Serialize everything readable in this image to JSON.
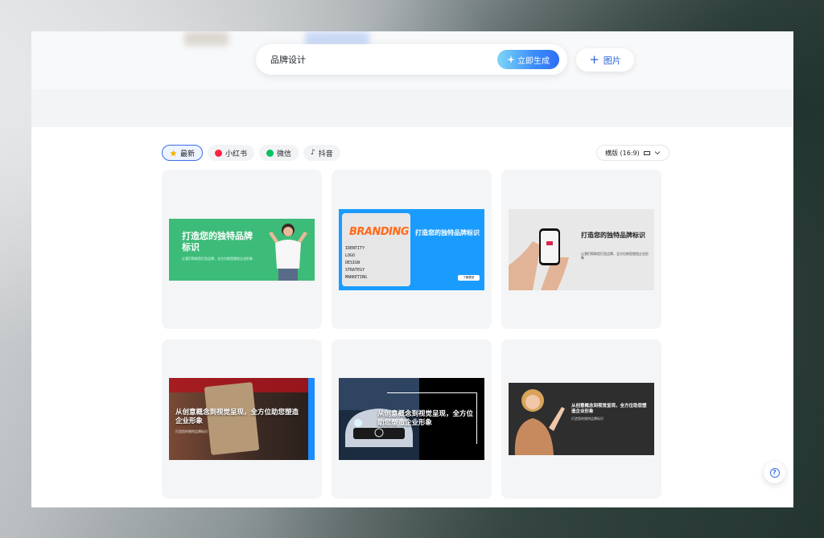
{
  "search": {
    "value": "品牌设计",
    "generate_label": "立即生成",
    "generate_icon": "sparkle-icon"
  },
  "image_button": {
    "label": "图片",
    "icon": "plus-icon"
  },
  "filters": [
    {
      "label": "最新",
      "icon": "star-icon",
      "color": "#f5b400",
      "active": true
    },
    {
      "label": "小红书",
      "icon": "xiaohongshu-icon",
      "color": "#ff2442",
      "active": false
    },
    {
      "label": "微信",
      "icon": "wechat-icon",
      "color": "#07c160",
      "active": false
    },
    {
      "label": "抖音",
      "icon": "douyin-icon",
      "color": "#111111",
      "active": false
    }
  ],
  "ratio_select": {
    "label": "横版 (16:9)"
  },
  "templates": [
    {
      "title": "打造您的独特品牌标识",
      "sub": "让我们帮助您打造品牌，全方位助您塑造企业形象",
      "bg": "#3dbc79"
    },
    {
      "title": "打造您的独特品牌标识",
      "art": "BRANDING",
      "lines": [
        "IDENTITY",
        "LOGO",
        "DESIGN",
        "STRATEGY",
        "MARKETING"
      ],
      "button": "了解更多",
      "bg": "#1a9cff"
    },
    {
      "title": "打造您的独特品牌标识",
      "sub": "让我们帮助您打造品牌，全方位助您塑造企业形象",
      "bg": "#e8e8e8"
    },
    {
      "title": "从创意概念到视觉呈现，全方位助您塑造企业形象",
      "sub": "打造您的独特品牌标识",
      "bg": "#6a3a2a"
    },
    {
      "title": "从创意概念到视觉呈现，全方位助您塑造企业形象",
      "bg": "#000000"
    },
    {
      "title": "从创意概念到视觉呈现，全方位助您塑造企业形象",
      "sub": "打造您的独特品牌标识",
      "bg": "#2e2e2e"
    }
  ],
  "colors": {
    "accent": "#2f6cf6"
  }
}
